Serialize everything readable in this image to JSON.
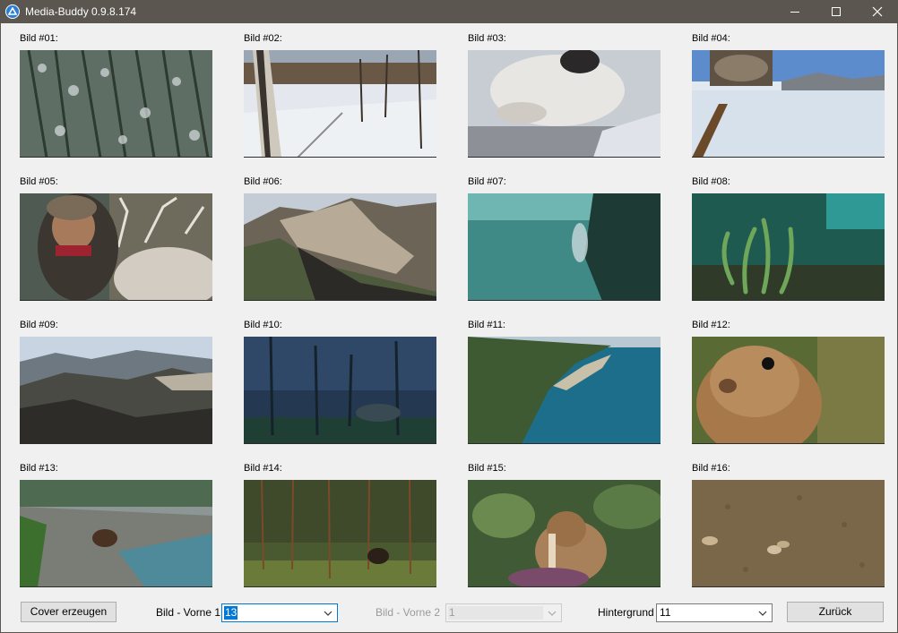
{
  "window": {
    "title": "Media-Buddy 0.9.8.174",
    "app_icon": "media-buddy-logo-icon",
    "controls": {
      "minimize": "minimize-icon",
      "maximize": "maximize-icon",
      "close": "close-icon"
    }
  },
  "thumbnails": [
    {
      "label": "Bild #01:",
      "subject": "snowy-forest-aerial"
    },
    {
      "label": "Bild #02:",
      "subject": "snowy-birch-forest"
    },
    {
      "label": "Bild #03:",
      "subject": "seal-pup-on-ice"
    },
    {
      "label": "Bild #04:",
      "subject": "reindeer-sled-snow"
    },
    {
      "label": "Bild #05:",
      "subject": "herder-with-reindeer"
    },
    {
      "label": "Bild #06:",
      "subject": "mountain-ridge"
    },
    {
      "label": "Bild #07:",
      "subject": "underwater-diver"
    },
    {
      "label": "Bild #08:",
      "subject": "underwater-sponges"
    },
    {
      "label": "Bild #09:",
      "subject": "rocky-mountains"
    },
    {
      "label": "Bild #10:",
      "subject": "night-forest-wolf"
    },
    {
      "label": "Bild #11:",
      "subject": "coastline-aerial"
    },
    {
      "label": "Bild #12:",
      "subject": "ground-squirrel"
    },
    {
      "label": "Bild #13:",
      "subject": "bear-on-riverbank"
    },
    {
      "label": "Bild #14:",
      "subject": "bear-in-pine-forest"
    },
    {
      "label": "Bild #15:",
      "subject": "chipmunk-eating"
    },
    {
      "label": "Bild #16:",
      "subject": "deer-on-steppe"
    }
  ],
  "controls": {
    "cover_button": "Cover erzeugen",
    "front1_label": "Bild - Vorne 1",
    "front1_value": "13",
    "front2_label": "Bild - Vorne 2",
    "front2_value": "1",
    "background_label": "Hintergrund",
    "background_value": "11",
    "back_button": "Zurück"
  },
  "colors": {
    "titlebar": "#5c5651",
    "focus_accent": "#0078d7",
    "window_bg": "#f0f0f0"
  }
}
